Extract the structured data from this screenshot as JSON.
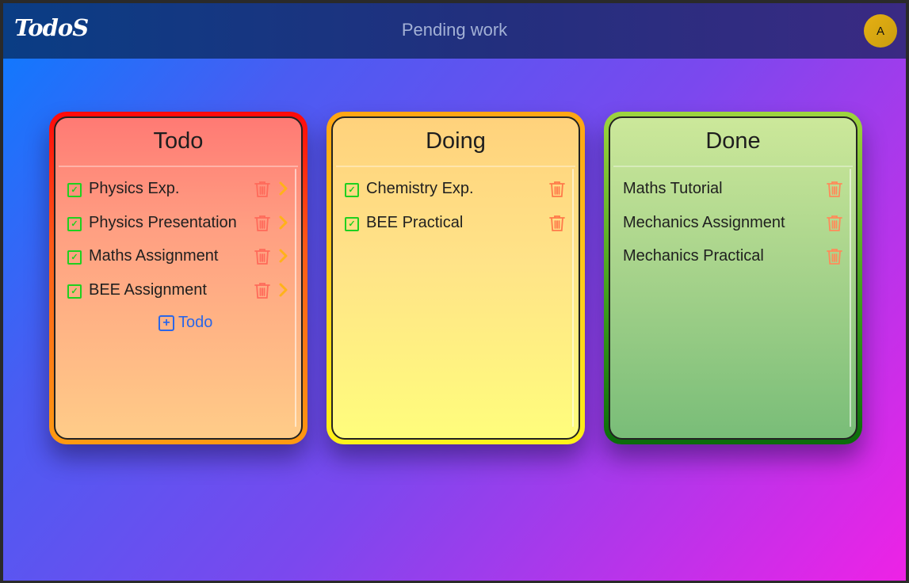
{
  "app": {
    "brand": "TodoS",
    "nav_title": "Pending work",
    "avatar_initial": "A"
  },
  "colors": {
    "todo_accent": "#ff0a0a",
    "doing_accent": "#ffd21a",
    "done_accent": "#3a9b1a",
    "checkbox": "#1fd01f",
    "trash": "#ff6a5a",
    "chevron": "#ffb21a",
    "link": "#2b66e8"
  },
  "boards": [
    {
      "title": "Todo",
      "tasks": [
        {
          "label": "Physics Exp.",
          "checked": true,
          "icons": [
            "trash-icon",
            "chevron-right-icon"
          ]
        },
        {
          "label": "Physics Presentation",
          "checked": true,
          "icons": [
            "trash-icon",
            "chevron-right-icon"
          ]
        },
        {
          "label": "Maths Assignment",
          "checked": true,
          "icons": [
            "trash-icon",
            "chevron-right-icon"
          ]
        },
        {
          "label": "BEE Assignment",
          "checked": true,
          "icons": [
            "trash-icon",
            "chevron-right-icon"
          ]
        }
      ],
      "add_label": "Todo"
    },
    {
      "title": "Doing",
      "tasks": [
        {
          "label": "Chemistry Exp.",
          "checked": true,
          "icons": [
            "trash-icon"
          ]
        },
        {
          "label": "BEE Practical",
          "checked": true,
          "icons": [
            "trash-icon"
          ]
        }
      ]
    },
    {
      "title": "Done",
      "tasks": [
        {
          "label": "Maths Tutorial",
          "checked": false,
          "icons": [
            "trash-icon"
          ]
        },
        {
          "label": "Mechanics Assignment",
          "checked": false,
          "icons": [
            "trash-icon"
          ]
        },
        {
          "label": "Mechanics Practical",
          "checked": false,
          "icons": [
            "trash-icon"
          ]
        }
      ]
    }
  ]
}
